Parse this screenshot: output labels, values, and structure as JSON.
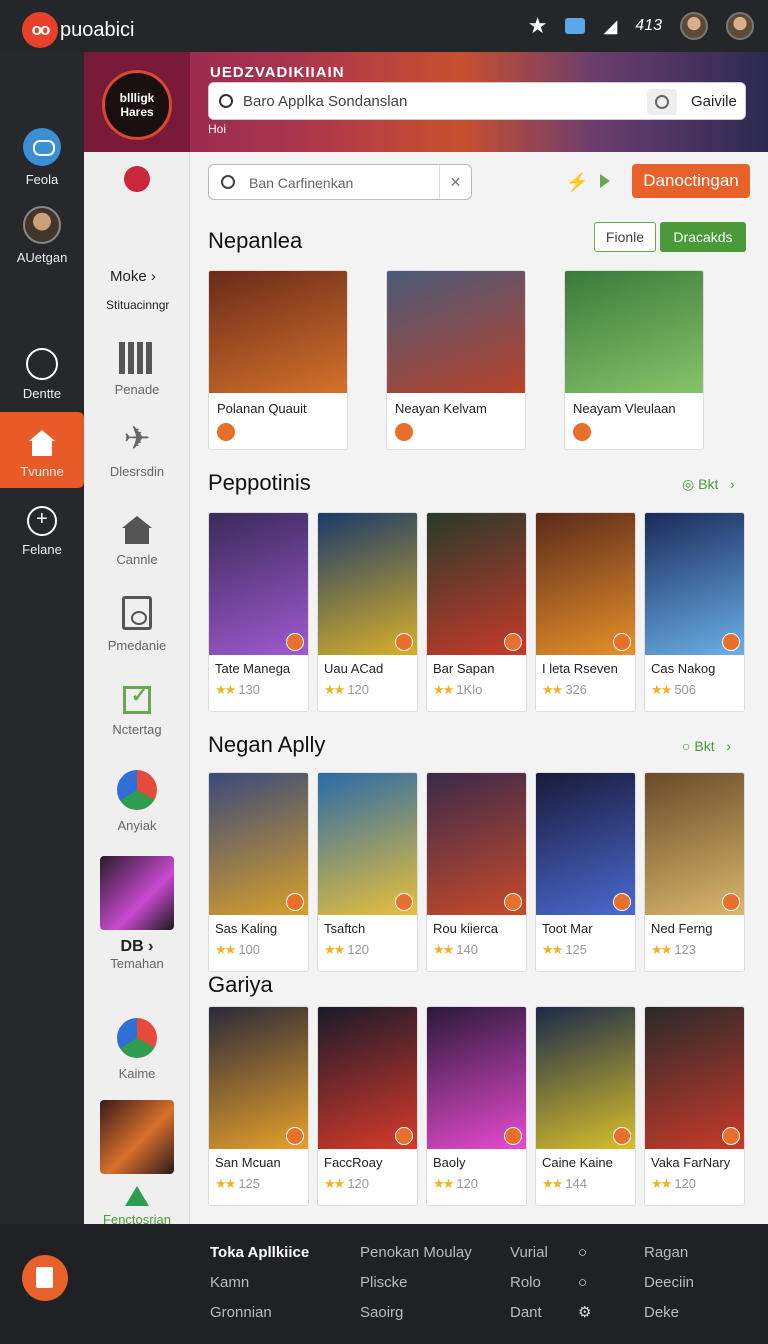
{
  "app": {
    "logo_mark": "oo",
    "logo_text": "puoabici"
  },
  "topbar": {
    "status_text": "413"
  },
  "rail": {
    "items": [
      {
        "label": "Feola",
        "icon": "cloud-icon"
      },
      {
        "label": "AUetgan",
        "icon": "avatar"
      },
      {
        "label": "Dentte",
        "icon": "circle-icon"
      },
      {
        "label": "Tvunne",
        "icon": "home-icon",
        "active": true
      },
      {
        "label": "Felane",
        "icon": "globe-icon"
      }
    ]
  },
  "banner": {
    "badge_text": "bllligk Hares",
    "title": "UEDZVADIKIIAIN",
    "search_placeholder": "Baro Applka Sondanslan",
    "search_button": "Gaivile",
    "small_text": "Hoi"
  },
  "subside": {
    "moke": "Moke",
    "moke_sub": "Stituacinngr",
    "items": [
      {
        "label": "Penade"
      },
      {
        "label": "Dlesrsdin"
      },
      {
        "label": "Cannle"
      },
      {
        "label": "Pmedanie"
      },
      {
        "label": "Nctertag"
      },
      {
        "label": "Anyiak"
      },
      {
        "label": "Temahan",
        "head": "DB"
      },
      {
        "label": "Kaime"
      },
      {
        "label": "Fenctosrian"
      }
    ]
  },
  "content": {
    "search_placeholder": "Ban Carfinenkan",
    "download_button": "Danoctingan",
    "sections": [
      {
        "title": "Nepanlea",
        "pill_outline": "Fionle",
        "pill_fill": "Dracakds"
      },
      {
        "title": "Peppotinis",
        "more": "Bkt"
      },
      {
        "title": "Negan Aplly",
        "more": "Bkt"
      },
      {
        "title": "Gariya"
      }
    ],
    "featured": [
      {
        "name": "Polanan Quauit",
        "colors": [
          "#6b2a1a",
          "#d4722a"
        ]
      },
      {
        "name": "Neayan Kelvam",
        "colors": [
          "#4a5a7a",
          "#b8432a"
        ]
      },
      {
        "name": "Neayam Vleulaan",
        "colors": [
          "#3a7a3a",
          "#86c46a"
        ]
      }
    ],
    "popular": [
      {
        "name": "Tate Manega",
        "rating": "130",
        "colors": [
          "#3a2a5a",
          "#a05ad0"
        ]
      },
      {
        "name": "Uau ACad",
        "rating": "120",
        "colors": [
          "#1a3a6a",
          "#d8b02a"
        ]
      },
      {
        "name": "Bar Sapan",
        "rating": "1Klo",
        "colors": [
          "#2a3a2a",
          "#c83a2a"
        ]
      },
      {
        "name": "I leta Rseven",
        "rating": "326",
        "colors": [
          "#5a2a1a",
          "#e8902a"
        ]
      },
      {
        "name": "Cas Nakog",
        "rating": "506",
        "colors": [
          "#1a2a5a",
          "#6ab0e8"
        ]
      }
    ],
    "new": [
      {
        "name": "Sas Kaling",
        "rating": "100",
        "colors": [
          "#3a4a7a",
          "#d8a02a"
        ]
      },
      {
        "name": "Tsaftch",
        "rating": "120",
        "colors": [
          "#2a6aa8",
          "#e8c03a"
        ]
      },
      {
        "name": "Rou kiierca",
        "rating": "140",
        "colors": [
          "#3a2a4a",
          "#c84a2a"
        ]
      },
      {
        "name": "Toot Mar",
        "rating": "125",
        "colors": [
          "#1a1a3a",
          "#4a6ad0"
        ]
      },
      {
        "name": "Ned Ferng",
        "rating": "123",
        "colors": [
          "#6a4a2a",
          "#d8b86a"
        ]
      }
    ],
    "games": [
      {
        "name": "San Mcuan",
        "rating": "125",
        "colors": [
          "#2a2a3a",
          "#e8a02a"
        ]
      },
      {
        "name": "FaccRoay",
        "rating": "120",
        "colors": [
          "#1a1a2a",
          "#d83a2a"
        ]
      },
      {
        "name": "Baoly",
        "rating": "120",
        "colors": [
          "#2a1a3a",
          "#e84ad0"
        ]
      },
      {
        "name": "Caine Kaine",
        "rating": "144",
        "colors": [
          "#1a2a4a",
          "#d8c02a"
        ]
      },
      {
        "name": "Vaka FarNary",
        "rating": "120",
        "colors": [
          "#2a2a2a",
          "#c83a2a"
        ]
      }
    ]
  },
  "footer": {
    "columns": [
      {
        "items": [
          "Toka Apllkiice",
          "Kamn",
          "Gronnian"
        ]
      },
      {
        "items": [
          "Penokan Moulay",
          "Pliscke",
          "Saoirg"
        ]
      },
      {
        "items": [
          "Vurial",
          "Rolo",
          "Dant"
        ]
      },
      {
        "items": [
          "Ragan",
          "Deeciin",
          "Deke"
        ]
      }
    ]
  }
}
